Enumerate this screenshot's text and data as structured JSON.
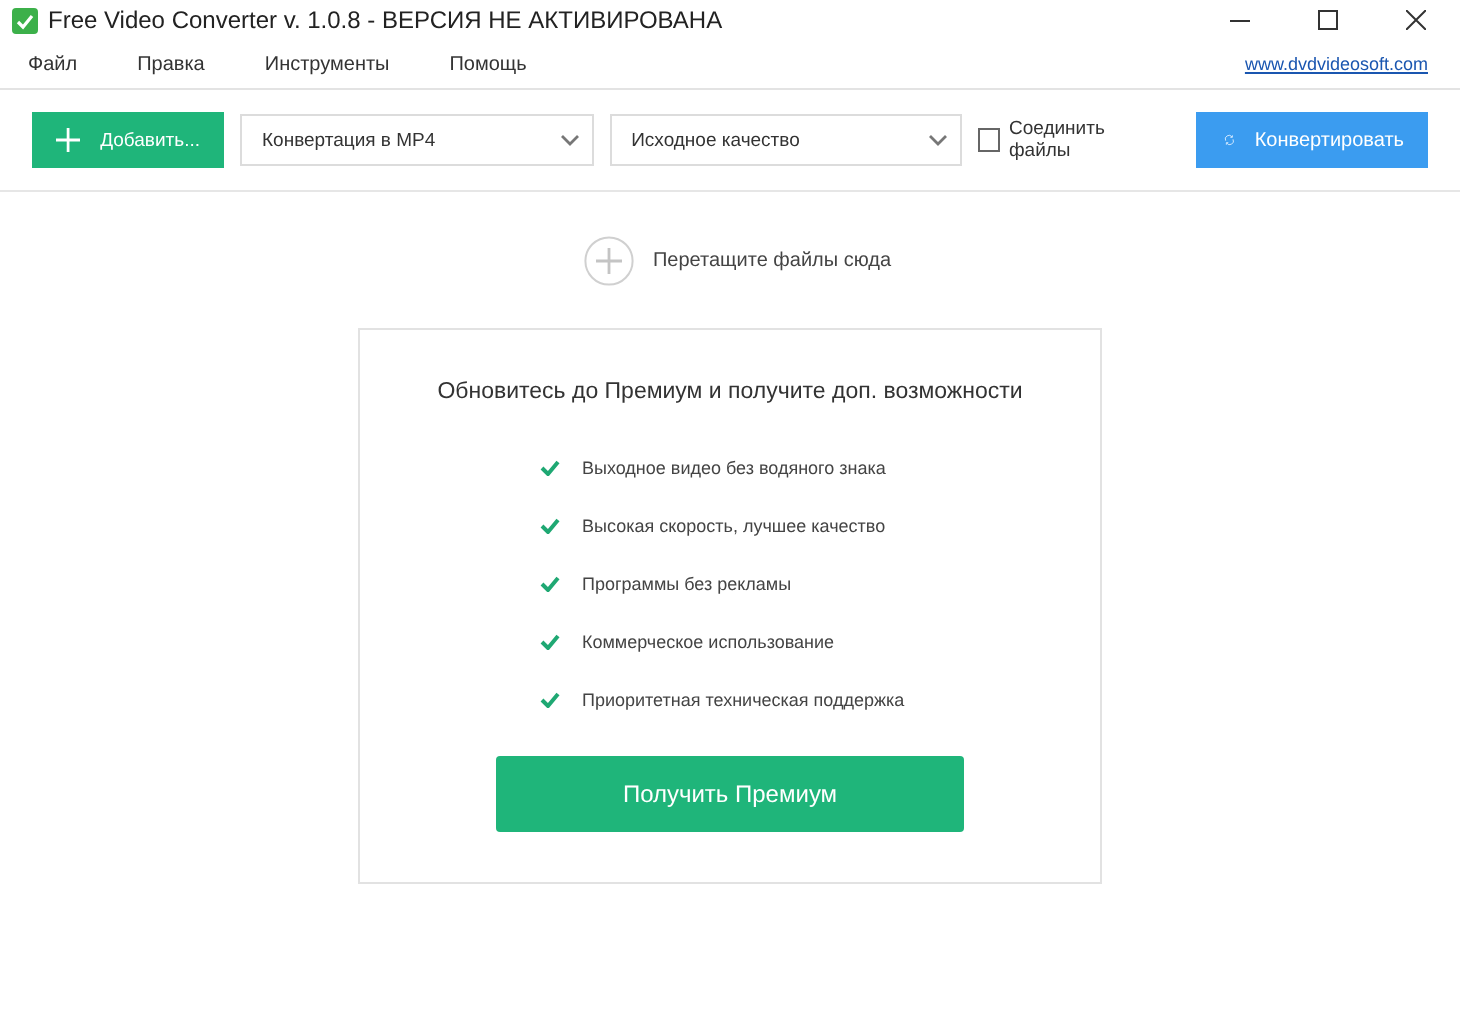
{
  "window": {
    "title": "Free Video Converter v. 1.0.8 - ВЕРСИЯ НЕ АКТИВИРОВАНА"
  },
  "menu": [
    "Файл",
    "Правка",
    "Инструменты",
    "Помощь"
  ],
  "website_link": "www.dvdvideosoft.com",
  "toolbar": {
    "add_button": "Добавить...",
    "format_dropdown": "Конвертация в MP4",
    "quality_dropdown": "Исходное качество",
    "join_files": {
      "label": "Соединить файлы",
      "checked": false
    },
    "convert_button": "Конвертировать"
  },
  "drop_zone": {
    "hint": "Перетащите файлы сюда"
  },
  "premium": {
    "heading": "Обновитесь до Премиум и получите доп. возможности",
    "features": [
      "Выходное видео без водяного знака",
      "Высокая скорость, лучшее качество",
      "Программы без рекламы",
      "Коммерческое использование",
      "Приоритетная техническая поддержка"
    ],
    "button": "Получить Премиум"
  }
}
